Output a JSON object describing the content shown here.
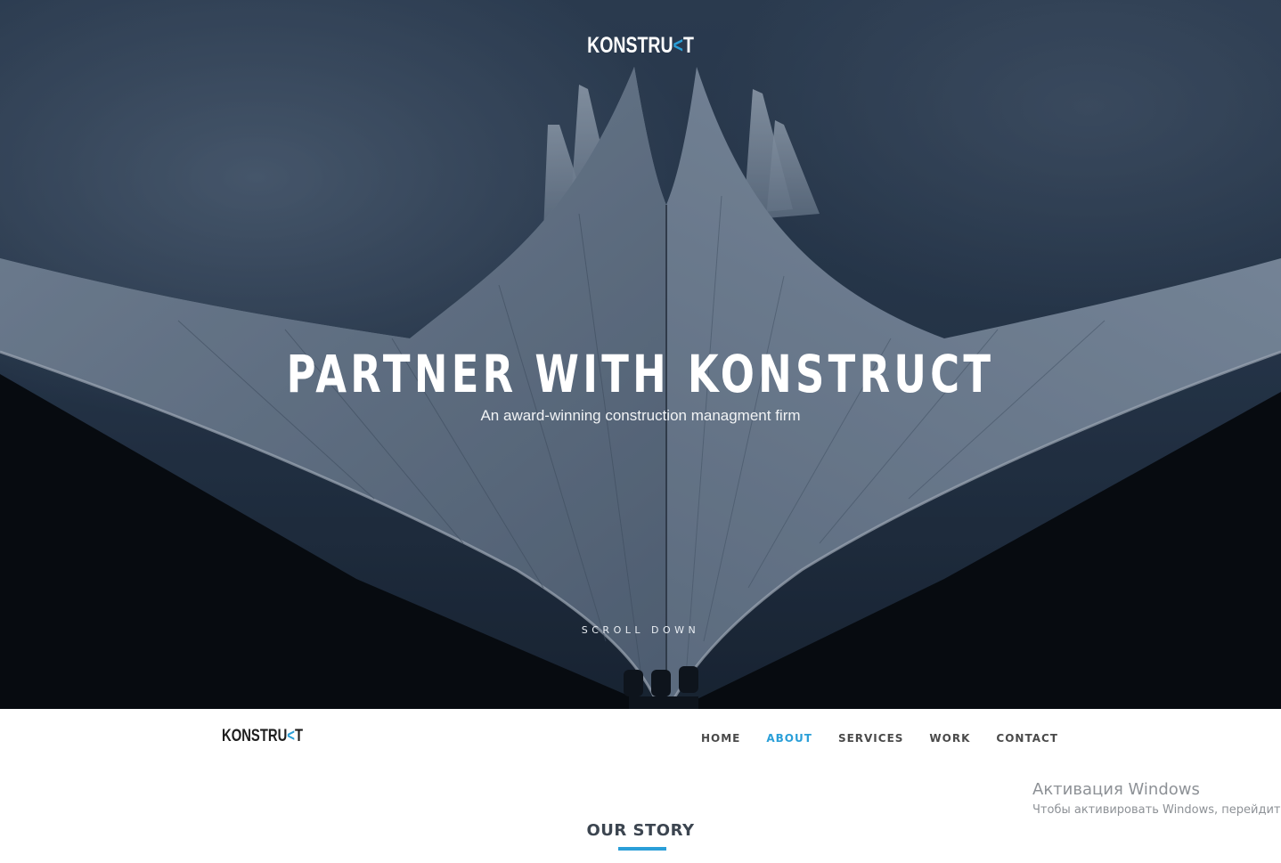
{
  "hero": {
    "logo_text": "KONSTRU",
    "logo_accent": "<",
    "logo_tail": "T",
    "title": "PARTNER WITH KONSTRUCT",
    "subtitle": "An award-winning construction managment firm",
    "scroll_label": "SCROLL DOWN"
  },
  "nav": {
    "logo_text": "KONSTRU",
    "logo_accent": "<",
    "logo_tail": "T",
    "items": [
      {
        "label": "HOME"
      },
      {
        "label": "ABOUT",
        "active": true
      },
      {
        "label": "SERVICES"
      },
      {
        "label": "WORK"
      },
      {
        "label": "CONTACT"
      }
    ]
  },
  "story": {
    "title": "OUR STORY"
  },
  "watermark": {
    "title": "Активация Windows",
    "subtitle": "Чтобы активировать Windows, перейдите"
  },
  "colors": {
    "accent": "#2a9fd8",
    "nav_text": "#4a4a4a",
    "heading": "#3c4550"
  }
}
